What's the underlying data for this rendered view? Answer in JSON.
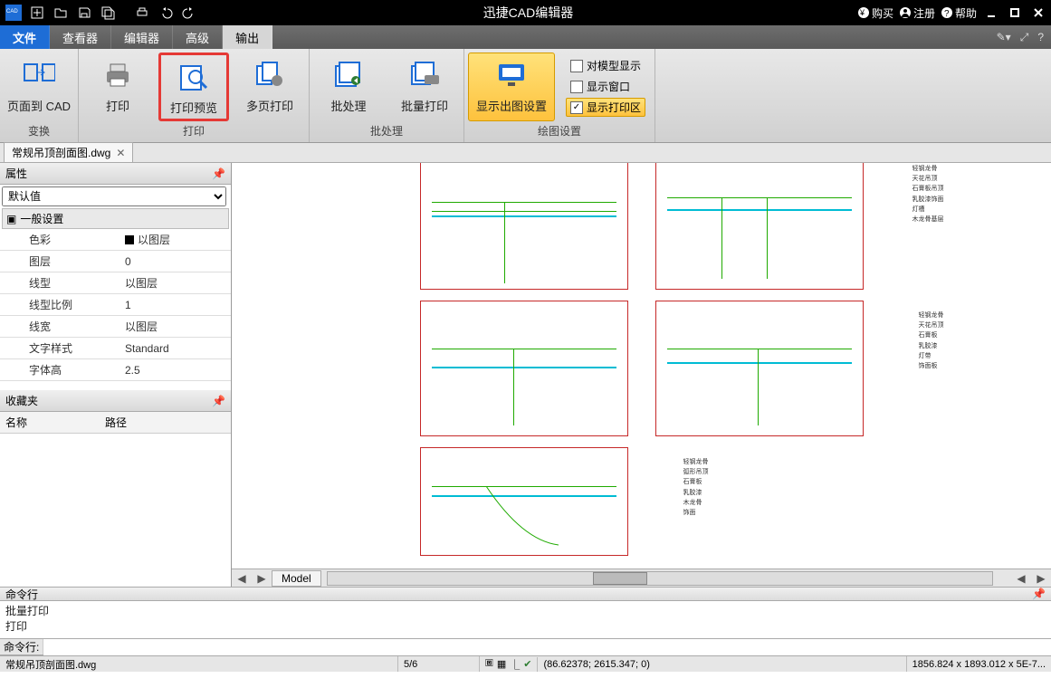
{
  "app": {
    "title": "迅捷CAD编辑器"
  },
  "titlebar_right": {
    "buy": "购买",
    "register": "注册",
    "help": "帮助"
  },
  "tabs": {
    "file": "文件",
    "viewer": "查看器",
    "editor": "编辑器",
    "advanced": "高级",
    "output": "输出"
  },
  "ribbon": {
    "group_transform": {
      "label": "变换",
      "page_to_cad": "页面到 CAD"
    },
    "group_print": {
      "label": "打印",
      "print": "打印",
      "preview": "打印预览",
      "multipage": "多页打印"
    },
    "group_batch": {
      "label": "批处理",
      "batch": "批处理",
      "batch_print": "批量打印"
    },
    "group_plot": {
      "label": "绘图设置",
      "plot_settings": "显示出图设置",
      "opt_model": "对模型显示",
      "opt_window": "显示窗口",
      "opt_printzone": "显示打印区"
    }
  },
  "doc": {
    "filename": "常规吊顶剖面图.dwg"
  },
  "properties": {
    "panel_title": "属性",
    "default_selector": "默认值",
    "section_general": "一般设置",
    "rows": {
      "color": {
        "k": "色彩",
        "v": "以图层"
      },
      "layer": {
        "k": "图层",
        "v": "0"
      },
      "linetype": {
        "k": "线型",
        "v": "以图层"
      },
      "lts": {
        "k": "线型比例",
        "v": "1"
      },
      "lw": {
        "k": "线宽",
        "v": "以图层"
      },
      "textstyle": {
        "k": "文字样式",
        "v": "Standard"
      },
      "textheight": {
        "k": "字体高",
        "v": "2.5"
      }
    }
  },
  "favorites": {
    "panel_title": "收藏夹",
    "col_name": "名称",
    "col_path": "路径"
  },
  "modelspace": {
    "tab": "Model"
  },
  "command": {
    "panel_title": "命令行",
    "history1": "批量打印",
    "history2": "打印",
    "prompt": "命令行:"
  },
  "status": {
    "filename": "常规吊顶剖面图.dwg",
    "page": "5/6",
    "coords": "(86.62378; 2615.347; 0)",
    "extents": "1856.824 x 1893.012 x 5E-7..."
  }
}
